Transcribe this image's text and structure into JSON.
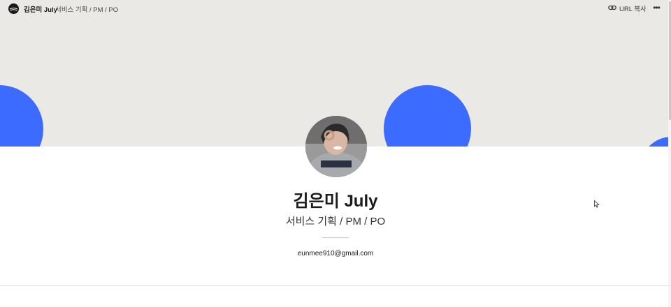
{
  "header": {
    "brand_name": "김은미 July",
    "brand_subtitle": "서비스 기획 / PM / PO",
    "copy_url_label": "URL 복사",
    "more_label": "•••"
  },
  "profile": {
    "name": "김은미 July",
    "role": "서비스 기획 / PM / PO",
    "email": "eunmee910@gmail.com"
  },
  "icons": {
    "brand": "brand-logo-icon",
    "link": "link-icon",
    "more": "more-icon",
    "cursor": "mouse-cursor-icon"
  },
  "colors": {
    "cover_background": "#ebe9e5",
    "accent_circle": "#3b6cff",
    "text": "#1a1a1a"
  }
}
